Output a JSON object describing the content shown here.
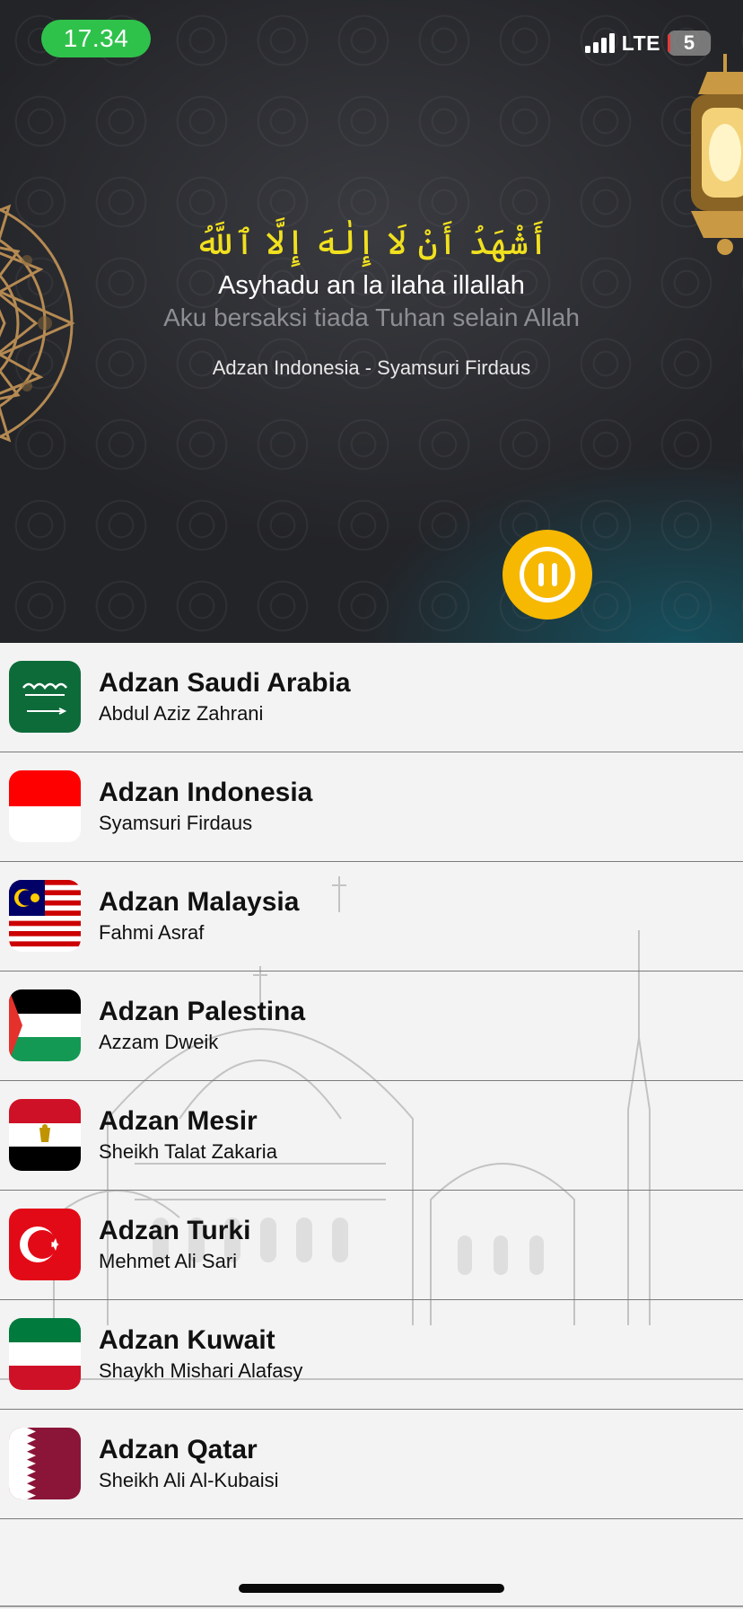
{
  "status_bar": {
    "time": "17.34",
    "network": "LTE",
    "battery": "5"
  },
  "player": {
    "arabic_text": "أَشْهَدُ أَنْ لَا إِلٰهَ إِلَّا ٱللَّهُ",
    "latin_text": "Asyhadu an la ilaha illallah",
    "translation": "Aku bersaksi tiada Tuhan selain Allah",
    "now_playing": "Adzan Indonesia - Syamsuri Firdaus",
    "state": "playing",
    "accent_color": "#f6b800",
    "arabic_color": "#f1e01f"
  },
  "adzan_list": [
    {
      "title": "Adzan Saudi Arabia",
      "reciter": "Abdul Aziz Zahrani",
      "flag": "saudi-arabia"
    },
    {
      "title": "Adzan Indonesia",
      "reciter": "Syamsuri Firdaus",
      "flag": "indonesia"
    },
    {
      "title": "Adzan Malaysia",
      "reciter": "Fahmi Asraf",
      "flag": "malaysia"
    },
    {
      "title": "Adzan Palestina",
      "reciter": "Azzam Dweik",
      "flag": "palestine"
    },
    {
      "title": "Adzan Mesir",
      "reciter": "Sheikh Talat Zakaria",
      "flag": "egypt"
    },
    {
      "title": "Adzan Turki",
      "reciter": "Mehmet Ali Sari",
      "flag": "turkey"
    },
    {
      "title": "Adzan Kuwait",
      "reciter": "Shaykh Mishari Alafasy",
      "flag": "kuwait"
    },
    {
      "title": "Adzan Qatar",
      "reciter": "Sheikh Ali Al-Kubaisi",
      "flag": "qatar"
    }
  ]
}
